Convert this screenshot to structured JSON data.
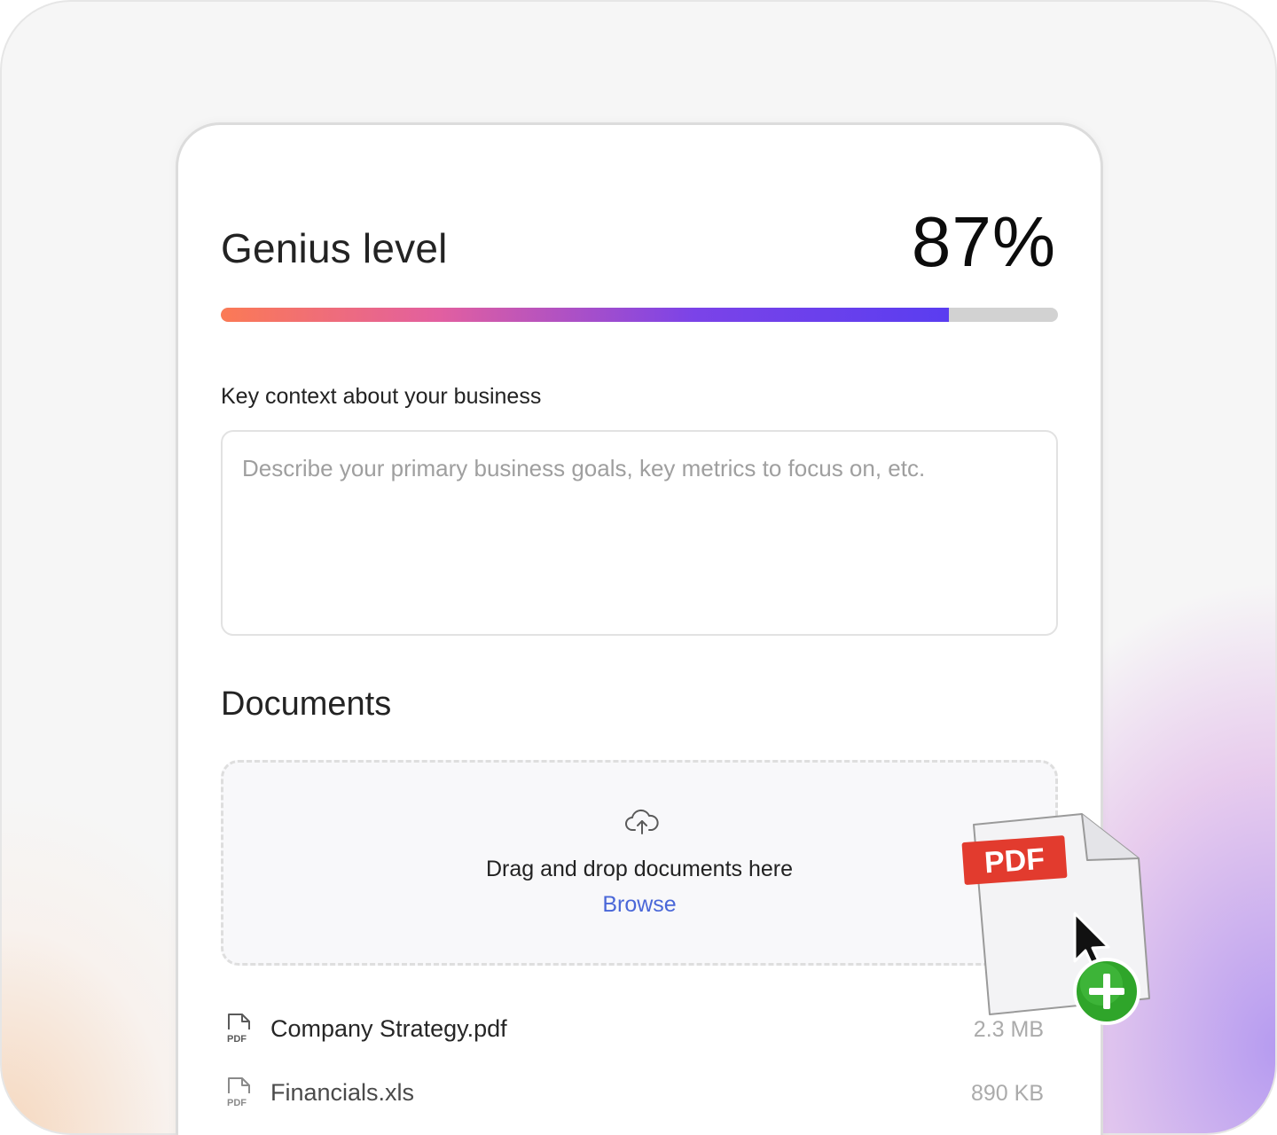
{
  "genius": {
    "title": "Genius level",
    "value_text": "87%",
    "progress": 0.87
  },
  "context": {
    "label": "Key context about your business",
    "placeholder": "Describe your primary business goals, key metrics to focus on, etc.",
    "value": ""
  },
  "documents": {
    "title": "Documents",
    "dropzone": {
      "icon": "cloud-upload-icon",
      "text": "Drag and drop documents here",
      "browse_label": "Browse"
    },
    "files": [
      {
        "name": "Company Strategy.pdf",
        "size": "2.3 MB",
        "icon": "pdf-file-icon"
      },
      {
        "name": "Financials.xls",
        "size": "890 KB",
        "icon": "pdf-file-icon"
      }
    ]
  },
  "dragged_item": {
    "badge": "PDF",
    "icon": "pdf-document-icon",
    "cursor_icon": "arrow-cursor-icon",
    "add_icon": "plus-badge-icon"
  },
  "colors": {
    "progress_start": "#fb7a55",
    "progress_end": "#5a3df0",
    "link": "#4a67d8",
    "pdf_badge": "#e23b2e",
    "add_badge": "#2fa52a"
  }
}
